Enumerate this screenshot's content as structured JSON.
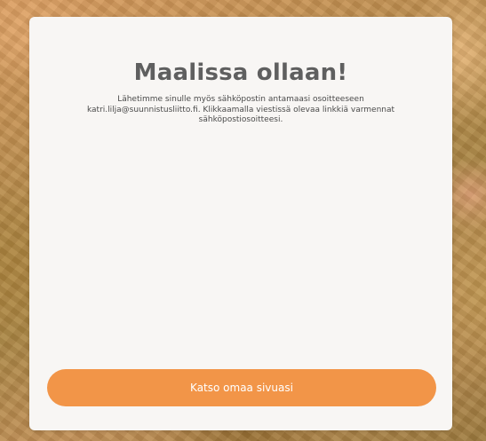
{
  "card": {
    "title": "Maalissa ollaan!",
    "message_line1": "Lähetimme sinulle myös sähköpostin antamaasi osoitteeseen",
    "message_line2": "katri.lilja@suunnistusliitto.fi. Klikkaamalla viestissä olevaa linkkiä varmennat",
    "message_line3": "sähköpostiosoitteesi.",
    "button_label": "Katso omaa sivuasi"
  },
  "colors": {
    "button": "#f29548",
    "card": "#f8f6f4",
    "title": "#5f5f5f"
  }
}
